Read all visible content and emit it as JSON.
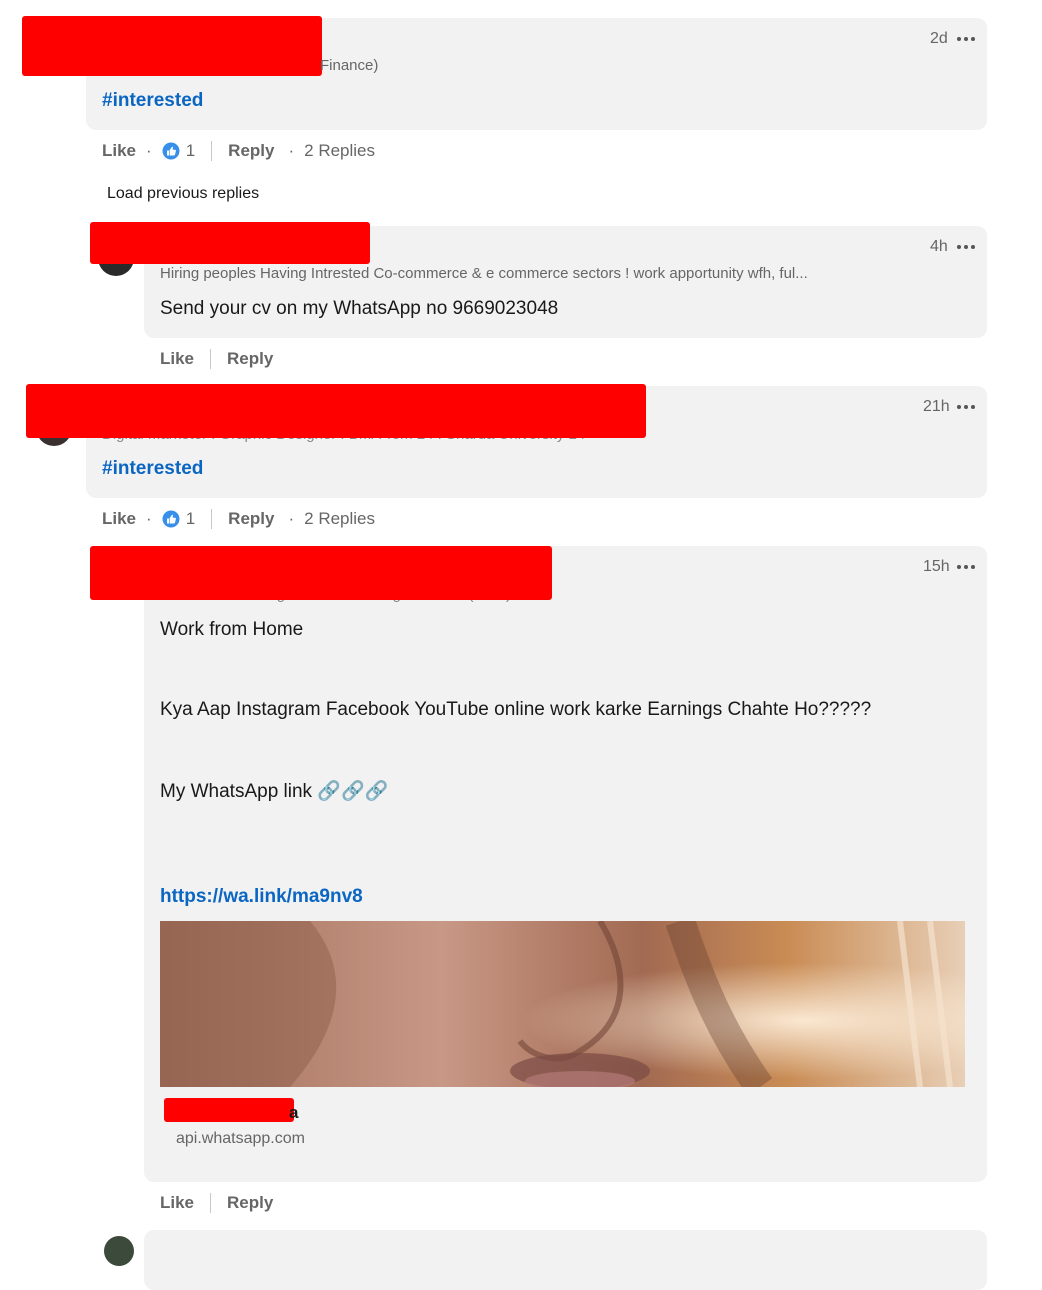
{
  "comments": [
    {
      "time": "2d",
      "subtitle_visible": "Finance)",
      "text": "#interested",
      "actions": {
        "like": "Like",
        "like_count": "1",
        "reply": "Reply",
        "replies": "2 Replies"
      }
    },
    {
      "time": "4h",
      "subtitle": "Hiring peoples Having Intrested Co-commerce & e commerce sectors ! work apportunity wfh, ful...",
      "text": "Send your cv on my WhatsApp no 9669023048",
      "actions": {
        "like": "Like",
        "reply": "Reply"
      }
    },
    {
      "time": "21h",
      "subtitle_visible": "Digital Marketer I Graphic Designer I BMA Tom 24 I Sharda University 24",
      "text": "#interested",
      "actions": {
        "like": "Like",
        "like_count": "1",
        "reply": "Reply",
        "replies": "2 Replies"
      }
    },
    {
      "time": "15h",
      "subtitle_visible": "Network Marketing at Forever Living Products (India)",
      "lines": [
        "Work from Home",
        "Kya Aap Instagram Facebook YouTube online work karke Earnings Chahte Ho?????",
        "My WhatsApp link 🔗🔗🔗"
      ],
      "link": "https://wa.link/ma9nv8",
      "preview": {
        "title_visible": "a",
        "domain": "api.whatsapp.com"
      },
      "actions": {
        "like": "Like",
        "reply": "Reply"
      }
    }
  ],
  "load_previous": "Load previous replies",
  "colors": {
    "accent": "#0a66c2",
    "bubble": "#f2f2f2",
    "redaction": "#ff0000"
  }
}
